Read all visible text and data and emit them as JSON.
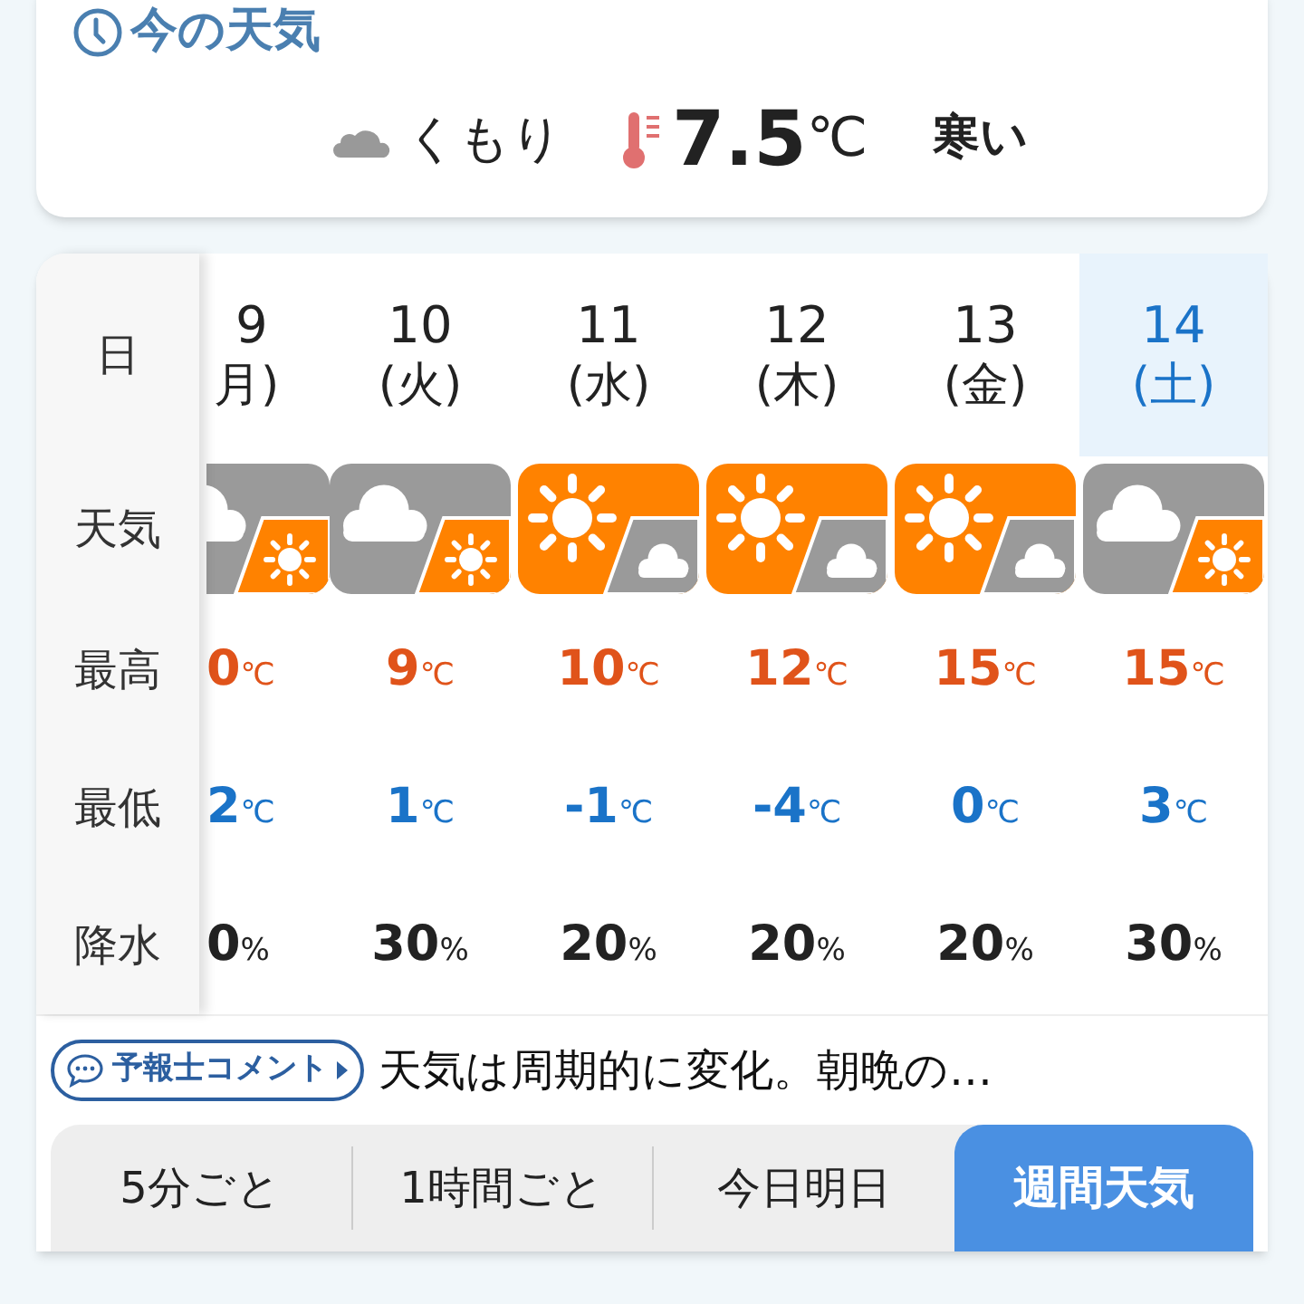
{
  "current": {
    "title": "今の天気",
    "condition": "くもり",
    "temperature": "7.5",
    "unit": "℃",
    "feeling": "寒い"
  },
  "forecast": {
    "labels": [
      "日",
      "天気",
      "最高",
      "最低",
      "降水"
    ],
    "days": [
      {
        "date": "9",
        "weekday": "月)",
        "selected": false,
        "partial": true,
        "kind": "cloud-sun",
        "high": {
          "value": "0",
          "unit": "℃"
        },
        "low": {
          "value": "2",
          "unit": "℃"
        },
        "rain": {
          "value": "0",
          "unit": "%"
        }
      },
      {
        "date": "10",
        "weekday": "(火)",
        "selected": false,
        "partial": false,
        "kind": "cloud-sun",
        "high": {
          "value": "9",
          "unit": "℃"
        },
        "low": {
          "value": "1",
          "unit": "℃"
        },
        "rain": {
          "value": "30",
          "unit": "%"
        }
      },
      {
        "date": "11",
        "weekday": "(水)",
        "selected": false,
        "partial": false,
        "kind": "sun-cloud",
        "high": {
          "value": "10",
          "unit": "℃"
        },
        "low": {
          "value": "-1",
          "unit": "℃"
        },
        "rain": {
          "value": "20",
          "unit": "%"
        }
      },
      {
        "date": "12",
        "weekday": "(木)",
        "selected": false,
        "partial": false,
        "kind": "sun-cloud",
        "high": {
          "value": "12",
          "unit": "℃"
        },
        "low": {
          "value": "-4",
          "unit": "℃"
        },
        "rain": {
          "value": "20",
          "unit": "%"
        }
      },
      {
        "date": "13",
        "weekday": "(金)",
        "selected": false,
        "partial": false,
        "kind": "sun-cloud",
        "high": {
          "value": "15",
          "unit": "℃"
        },
        "low": {
          "value": "0",
          "unit": "℃"
        },
        "rain": {
          "value": "20",
          "unit": "%"
        }
      },
      {
        "date": "14",
        "weekday": "(土)",
        "selected": true,
        "partial": false,
        "kind": "cloud-sun",
        "high": {
          "value": "15",
          "unit": "℃"
        },
        "low": {
          "value": "3",
          "unit": "℃"
        },
        "rain": {
          "value": "30",
          "unit": "%"
        }
      }
    ]
  },
  "comment": {
    "badge": "予報士コメント",
    "text": "天気は周期的に変化。朝晩の…"
  },
  "tabs": [
    {
      "label": "5分ごと",
      "selected": false
    },
    {
      "label": "1時間ごと",
      "selected": false
    },
    {
      "label": "今日明日",
      "selected": false
    },
    {
      "label": "週間天気",
      "selected": true
    }
  ]
}
